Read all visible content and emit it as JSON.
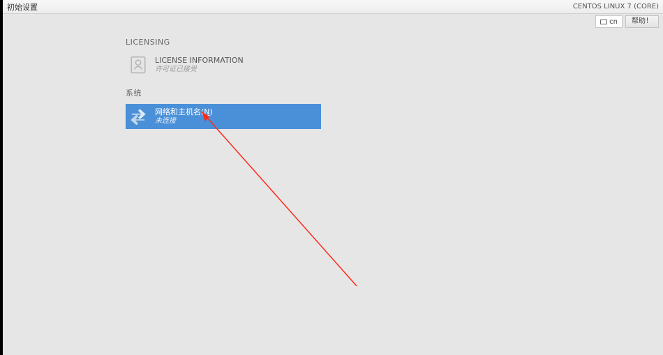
{
  "titlebar": {
    "app_title": "初始设置",
    "distro": "CENTOS LINUX 7 (CORE)"
  },
  "toolbar": {
    "lang_code": "cn",
    "help_label": "帮助！"
  },
  "sections": {
    "licensing": {
      "heading": "LICENSING",
      "license": {
        "title": "LICENSE INFORMATION",
        "status": "许可证已接受"
      }
    },
    "system": {
      "heading": "系统",
      "network": {
        "title_prefix": "网络和主机名(",
        "title_hotkey": "N",
        "title_suffix": ")",
        "status": "未连接"
      }
    }
  },
  "colors": {
    "selected_bg": "#4a90d9"
  }
}
